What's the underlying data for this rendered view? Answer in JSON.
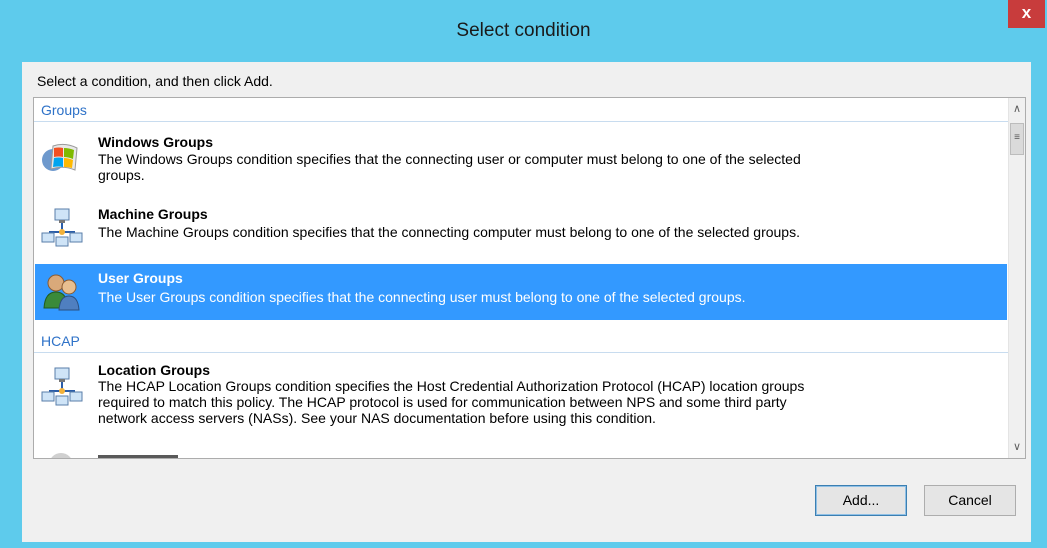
{
  "window": {
    "title": "Select condition",
    "close_label": "x"
  },
  "instruction": "Select a condition, and then click Add.",
  "list": {
    "groups": [
      {
        "header": "Groups",
        "items": [
          {
            "title": "Windows Groups",
            "desc_lines": [
              "The Windows Groups condition specifies that the connecting user or computer must belong to one of the selected",
              "groups."
            ],
            "icon": "windows-groups-icon"
          },
          {
            "title": "Machine Groups",
            "desc_lines": [
              "The Machine Groups condition specifies that the connecting computer must belong to one of the selected groups."
            ],
            "icon": "machine-groups-icon"
          },
          {
            "title": "User Groups",
            "desc_lines": [
              "The User Groups condition specifies that the connecting user must belong to one of the selected groups."
            ],
            "icon": "user-groups-icon",
            "selected": true
          }
        ]
      },
      {
        "header": "HCAP",
        "items": [
          {
            "title": "Location Groups",
            "desc_lines": [
              "The HCAP Location Groups condition specifies the Host Credential Authorization Protocol (HCAP) location groups",
              "required to match this policy. The HCAP protocol is used for communication between NPS and some third party",
              "network access servers (NASs). See your NAS documentation before using this condition."
            ],
            "icon": "location-groups-icon"
          }
        ]
      }
    ]
  },
  "buttons": {
    "add": "Add...",
    "cancel": "Cancel"
  },
  "colors": {
    "titlebar": "#5ecbec",
    "selection": "#3399ff",
    "group_header": "#2e72c8",
    "close": "#c83c3c"
  }
}
